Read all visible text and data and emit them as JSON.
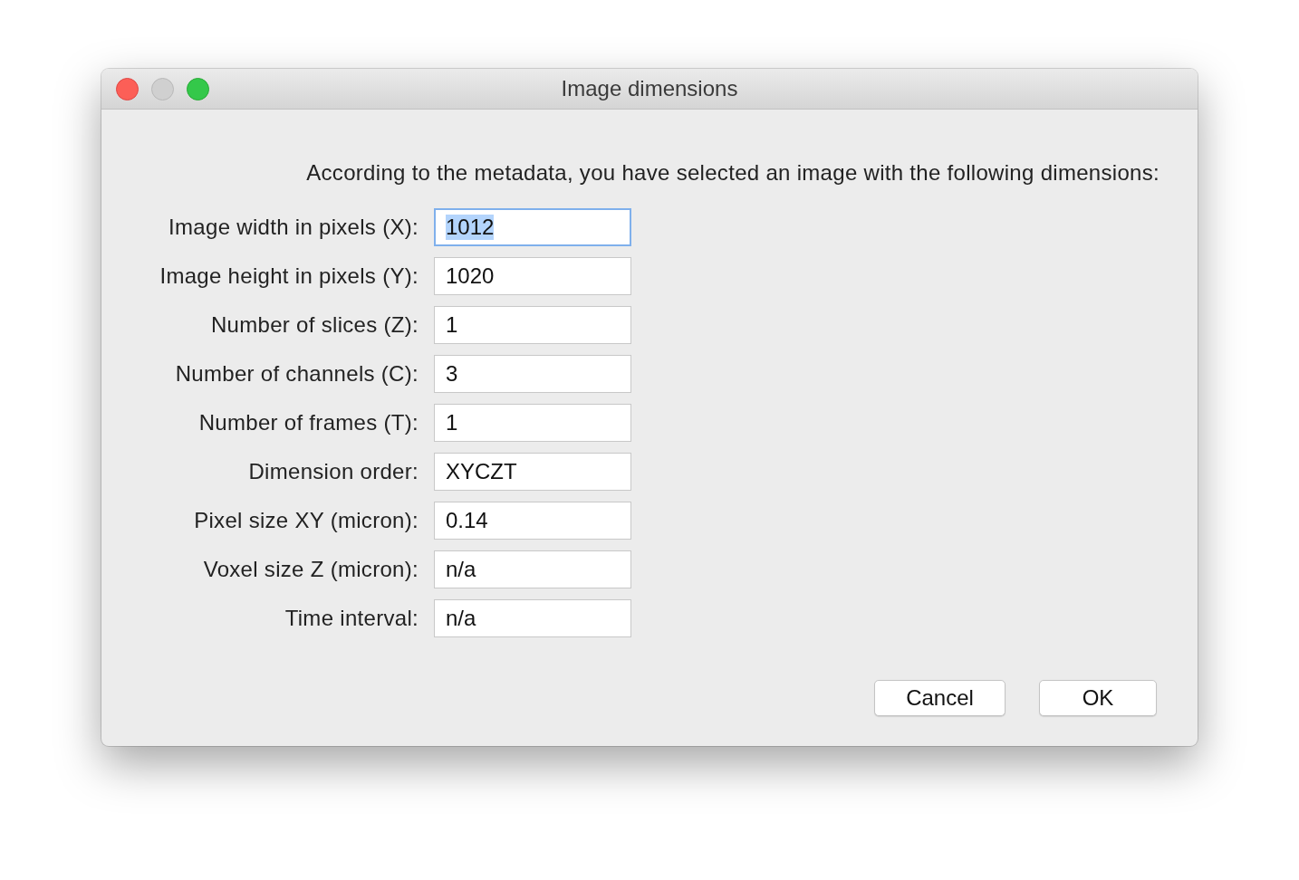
{
  "window": {
    "title": "Image dimensions"
  },
  "intro": "According to the metadata, you have selected an image with the following dimensions:",
  "fields": [
    {
      "label": "Image width in pixels (X):",
      "value": "1012",
      "focused": true
    },
    {
      "label": "Image height in pixels (Y):",
      "value": "1020",
      "focused": false
    },
    {
      "label": "Number of slices (Z):",
      "value": "1",
      "focused": false
    },
    {
      "label": "Number of channels (C):",
      "value": "3",
      "focused": false
    },
    {
      "label": "Number of frames (T):",
      "value": "1",
      "focused": false
    },
    {
      "label": "Dimension order:",
      "value": "XYCZT",
      "focused": false
    },
    {
      "label": "Pixel size XY (micron):",
      "value": "0.14",
      "focused": false
    },
    {
      "label": "Voxel size Z (micron):",
      "value": "n/a",
      "focused": false
    },
    {
      "label": "Time interval:",
      "value": "n/a",
      "focused": false
    }
  ],
  "buttons": [
    "Cancel",
    "OK"
  ]
}
